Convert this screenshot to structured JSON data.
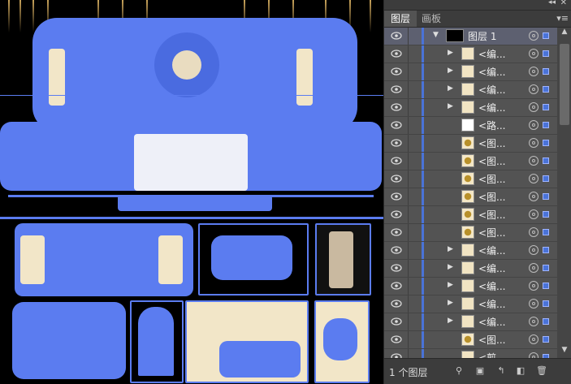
{
  "panel": {
    "tabs": [
      {
        "label": "图层",
        "active": true
      },
      {
        "label": "画板",
        "active": false
      }
    ],
    "collapse_glyph": "◂◂",
    "close_glyph": "✕",
    "menu_glyph": "▾≡",
    "footer": {
      "layer_count": "1 个图层"
    }
  },
  "layers": [
    {
      "name": "图层 1",
      "kind": "layer",
      "expanded": true
    },
    {
      "name": "<编...",
      "kind": "group"
    },
    {
      "name": "<编...",
      "kind": "group"
    },
    {
      "name": "<编...",
      "kind": "group"
    },
    {
      "name": "<编...",
      "kind": "group"
    },
    {
      "name": "<路...",
      "kind": "path"
    },
    {
      "name": "<图...",
      "kind": "image"
    },
    {
      "name": "<图...",
      "kind": "image"
    },
    {
      "name": "<图...",
      "kind": "image"
    },
    {
      "name": "<图...",
      "kind": "image"
    },
    {
      "name": "<图...",
      "kind": "image"
    },
    {
      "name": "<图...",
      "kind": "image"
    },
    {
      "name": "<编...",
      "kind": "group"
    },
    {
      "name": "<编...",
      "kind": "group"
    },
    {
      "name": "<编...",
      "kind": "group"
    },
    {
      "name": "<编...",
      "kind": "group"
    },
    {
      "name": "<编...",
      "kind": "group"
    },
    {
      "name": "<图...",
      "kind": "image"
    },
    {
      "name": "<剪...",
      "kind": "clip"
    },
    {
      "name": "<编...",
      "kind": "group"
    }
  ],
  "colors": {
    "selection": "#5b7cf0",
    "panel_bg": "#535353",
    "canvas_bg": "#000000"
  }
}
